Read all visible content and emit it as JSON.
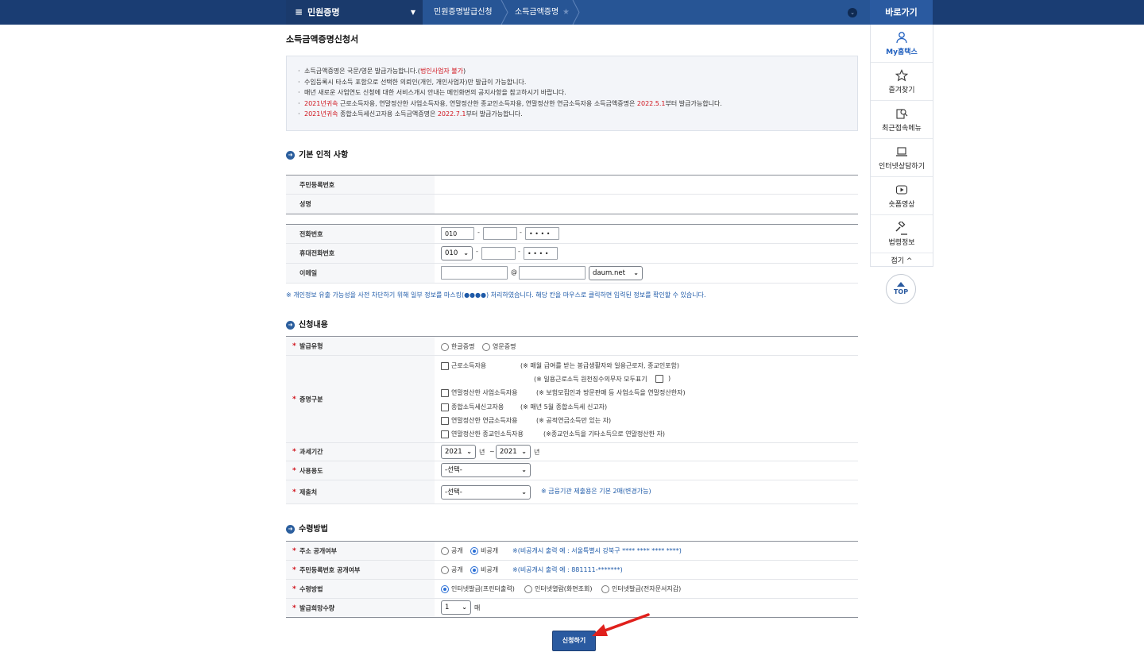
{
  "nav": {
    "main_label": "민원증명",
    "crumbs": [
      "민원증명발급신청",
      "소득금액증명"
    ],
    "quick_title": "바로가기"
  },
  "quick_menu": {
    "items": [
      "My홈택스",
      "즐겨찾기",
      "최근접속메뉴",
      "인터넷상담하기",
      "숏폼영상",
      "법령정보"
    ],
    "fold": "접기 ^",
    "top": "TOP"
  },
  "page_title": "소득금액증명신청서",
  "notice": [
    [
      "소득금액증명은 국문/영문 발급가능합니다.(",
      "법인사업자 불가",
      ")"
    ],
    [
      "수임등록시 타소득 포함으로 선택한 의뢰인(개인, 개인사업자)만 발급이 가능합니다.",
      "",
      ""
    ],
    [
      "매년 새로운 사업연도 신청에 대한 서비스개시 안내는 메인화면의 공지사항을 참고하시기 바랍니다.",
      "",
      ""
    ],
    [
      "",
      "2021년귀속",
      " 근로소득자용, 연말정산한 사업소득자용, 연말정산한 종교인소득자용, 연말정산한 연금소득자용 소득금액증명은 ",
      "2022.5.1",
      "부터 발급가능합니다."
    ],
    [
      "",
      "2021년귀속",
      " 종합소득세신고자용 소득금액증명은 ",
      "2022.7.1",
      "부터 발급가능합니다."
    ]
  ],
  "section1": {
    "title": "기본 인적 사항",
    "rrn_label": "주민등록번호",
    "name_label": "성명",
    "phone_label": "전화번호",
    "phone": [
      "010",
      "",
      "• • • •"
    ],
    "mobile_label": "휴대전화번호",
    "mobile": [
      "010",
      "",
      "• • • •"
    ],
    "email_label": "이메일",
    "email_at": "@",
    "email_domain": "daum.net",
    "dash": "-",
    "privacy_note": "※ 개인정보 유출 가능성을 사전 차단하기 위해 일부 정보를 마스킹(●●●●) 처리하였습니다. 해당 칸을 마우스로 클릭하면 입력된 정보를 확인할 수 있습니다."
  },
  "section2": {
    "title": "신청내용",
    "issue_type_label": "발급유형",
    "issue_types": [
      "한글증명",
      "영문증명"
    ],
    "cert_label": "증명구분",
    "cert_items": [
      [
        "근로소득자용",
        "(※ 매월 급여를 받는 봉급생활자와 일용근로자, 종교인포함)"
      ],
      [
        "연말정산한 사업소득자용",
        "(※ 보험모집인과 방문판매 등 사업소득을 연말정산한자)"
      ],
      [
        "종합소득세신고자용",
        "(※ 매년 5월 종합소득세 신고자)"
      ],
      [
        "연말정산한 연금소득자용",
        "(※ 공적연금소득만 있는 자)"
      ],
      [
        "연말정산한 종교인소득자용",
        "(※종교인소득을 기타소득으로 연말정산한 자)"
      ]
    ],
    "daily_worker_note": "(※ 일용근로소득 원천징수의무자 모두표기",
    "daily_worker_close": ")",
    "tax_period_label": "과세기간",
    "year_from": "2021",
    "year_to": "2021",
    "year_unit": "년",
    "tilde": "~",
    "usage_label": "사용용도",
    "usage_value": "-선택-",
    "submit_to_label": "제출처",
    "submit_to_value": "-선택-",
    "submit_to_note": "※ 금융기관 제출용은 기본 2매(변경가능)"
  },
  "section3": {
    "title": "수령방법",
    "addr_label": "주소 공개여부",
    "addr_options": [
      "공개",
      "비공개"
    ],
    "addr_note": "※(비공개시 출력 예 : 서울특별시 강북구 **** **** **** ****)",
    "rrn_label": "주민등록번호 공개여부",
    "rrn_options": [
      "공개",
      "비공개"
    ],
    "rrn_note": "※(비공개시 출력 예 : 881111-*******)",
    "recv_label": "수령방법",
    "recv_options": [
      "인터넷발급(프린터출력)",
      "인터넷열람(화면조회)",
      "인터넷발급(전자문서지갑)"
    ],
    "qty_label": "발급희망수량",
    "qty_value": "1",
    "qty_unit": "매"
  },
  "required_mark": "*",
  "submit_label": "신청하기"
}
